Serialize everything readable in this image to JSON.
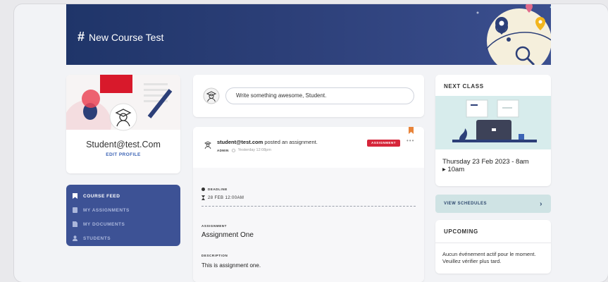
{
  "course": {
    "title": "New Course Test",
    "hash_icon": "#"
  },
  "profile": {
    "name": "Student@test.Com",
    "edit_label": "EDIT PROFILE"
  },
  "nav": {
    "items": [
      {
        "label": "COURSE FEED",
        "icon": "bookmark-icon",
        "active": true
      },
      {
        "label": "MY ASSIGNMENTS",
        "icon": "assignment-icon",
        "active": false
      },
      {
        "label": "MY DOCUMENTS",
        "icon": "document-icon",
        "active": false
      },
      {
        "label": "STUDENTS",
        "icon": "user-icon",
        "active": false
      }
    ]
  },
  "composer": {
    "placeholder": "Write something awesome, Student."
  },
  "post": {
    "author": "student@test.com",
    "action": "posted an assignment.",
    "role": "ADMIN",
    "time": "Yesterday 12:08pm",
    "badge": "ASSIGNMENT",
    "more": "•••",
    "deadline_label": "DEADLINE",
    "deadline_value": "28 FEB 12:00AM",
    "assignment_label": "ASSIGNMENT",
    "assignment_value": "Assignment One",
    "description_label": "DESCRIPTION",
    "description_value": "This is assignment one."
  },
  "next_class": {
    "heading": "NEXT CLASS",
    "date_line1": "Thursday 23 Feb 2023 - 8am",
    "date_line2": "▸ 10am"
  },
  "schedules": {
    "label": "VIEW SCHEDULES",
    "chevron": "›"
  },
  "upcoming": {
    "heading": "UPCOMING",
    "text": "Aucun événement actif pour le moment. Veuillez vérifier plus tard."
  },
  "colors": {
    "banner": "#2c3f78",
    "nav_bg": "#3d5295",
    "badge": "#d6263a",
    "link": "#3b63b5",
    "schedule_btn": "#cfe3e4"
  }
}
